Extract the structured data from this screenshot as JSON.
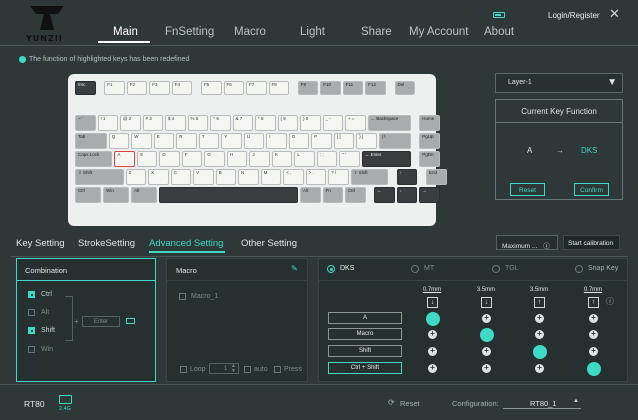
{
  "app": {
    "logo_text": "YUNZII",
    "login": "Login/Register"
  },
  "nav": [
    {
      "label": "Main"
    },
    {
      "label": "FnSetting"
    },
    {
      "label": "Macro"
    },
    {
      "label": "Light"
    },
    {
      "label": "Share"
    },
    {
      "label": "My Account"
    },
    {
      "label": "About"
    }
  ],
  "notice": "The function of highlighted keys has been redefined",
  "layer": {
    "selected": "Layer-1"
  },
  "current_key": {
    "title": "Current Key Function",
    "from": "A",
    "arrow": "→",
    "to": "DKS",
    "reset": "Reset",
    "confirm": "Confirm"
  },
  "tabs": [
    {
      "label": "Key Setting"
    },
    {
      "label": "StrokeSetting"
    },
    {
      "label": "Advanced Setting"
    },
    {
      "label": "Other Setting"
    }
  ],
  "maximum": "Maximum ...",
  "calibration": "Start calibration",
  "combination": {
    "title": "Combination",
    "mods": [
      "Ctrl",
      "Alt",
      "Shift",
      "Win"
    ],
    "checked": [
      true,
      false,
      true,
      false
    ],
    "enter_placeholder": "Enter"
  },
  "macro": {
    "title": "Macro",
    "items": [
      "Macro_1"
    ],
    "loop_label": "Loop",
    "loop_value": "1",
    "auto_label": "auto",
    "press_label": "Press"
  },
  "modes": [
    {
      "label": "DKS"
    },
    {
      "label": "MT"
    },
    {
      "label": "TGL"
    },
    {
      "label": "Snap Key"
    }
  ],
  "dks": {
    "columns": [
      {
        "dist": "0.7mm",
        "dir": "↓"
      },
      {
        "dist": "3.5mm",
        "dir": "↓"
      },
      {
        "dist": "3.5mm",
        "dir": "↑"
      },
      {
        "dist": "0.7mm",
        "dir": "↑"
      }
    ],
    "rows": [
      "A",
      "Macro",
      "Shift",
      "Ctrl + Shift"
    ],
    "active": [
      [
        true,
        false,
        false,
        false
      ],
      [
        false,
        true,
        false,
        false
      ],
      [
        false,
        false,
        true,
        false
      ],
      [
        false,
        false,
        false,
        true
      ]
    ]
  },
  "footer": {
    "device": "RT80",
    "badge": "2.4G",
    "reset": "Reset",
    "config_label": "Configuration:",
    "config_value": "RT80_1"
  },
  "keyboard_rows": [
    [
      "Esc",
      "F1",
      "F2",
      "F3",
      "F4",
      "F5",
      "F6",
      "F7",
      "F8",
      "F9",
      "F10",
      "F11",
      "F12",
      "Del"
    ],
    [
      "~ `",
      "! 1",
      "@ 2",
      "# 3",
      "$ 4",
      "% 5",
      "^ 6",
      "& 7",
      "* 8",
      "( 9",
      ") 0",
      "_ -",
      "+ =",
      "← Backspace",
      "Home"
    ],
    [
      "Tab",
      "Q",
      "W",
      "E",
      "R",
      "T",
      "Y",
      "U",
      "I",
      "O",
      "P",
      "{ [",
      "} ]",
      "| \\",
      "PgUp"
    ],
    [
      "Caps Lock",
      "A",
      "S",
      "D",
      "F",
      "G",
      "H",
      "J",
      "K",
      "L",
      ": ;",
      "\" '",
      "← Enter",
      "PgDn"
    ],
    [
      "⇧ Shift",
      "Z",
      "X",
      "C",
      "V",
      "B",
      "N",
      "M",
      "< ,",
      "> .",
      "? /",
      "⇧ Shift",
      "↑",
      "End"
    ],
    [
      "Ctrl",
      "Win",
      "Alt",
      "",
      "Alt",
      "Fn",
      "Ctrl",
      "←",
      "↓",
      "→"
    ]
  ]
}
